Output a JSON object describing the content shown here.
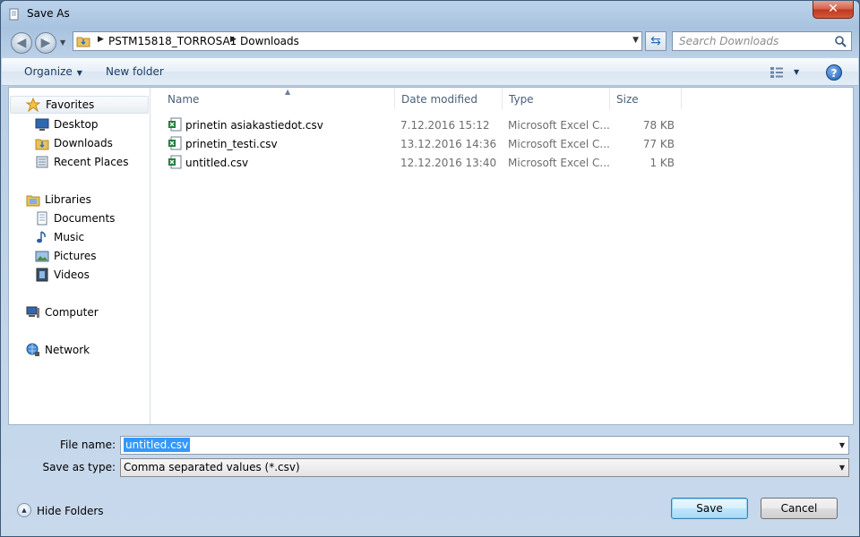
{
  "window": {
    "title": "Save As",
    "close_label": "✕"
  },
  "address": {
    "crumbs": [
      "PSTM15818_TORROSA1",
      "Downloads"
    ],
    "search_placeholder": "Search Downloads"
  },
  "toolbar": {
    "organize_label": "Organize",
    "new_folder_label": "New folder",
    "help_label": "?"
  },
  "sidebar": {
    "favorites": {
      "label": "Favorites",
      "items": [
        "Desktop",
        "Downloads",
        "Recent Places"
      ]
    },
    "libraries": {
      "label": "Libraries",
      "items": [
        "Documents",
        "Music",
        "Pictures",
        "Videos"
      ]
    },
    "computer_label": "Computer",
    "network_label": "Network"
  },
  "file_list": {
    "columns": [
      "Name",
      "Date modified",
      "Type",
      "Size"
    ],
    "rows": [
      {
        "name": "prinetin asiakastiedot.csv",
        "date": "7.12.2016 15:12",
        "type": "Microsoft Excel C...",
        "size": "78 KB"
      },
      {
        "name": "prinetin_testi.csv",
        "date": "13.12.2016 14:36",
        "type": "Microsoft Excel C...",
        "size": "77 KB"
      },
      {
        "name": "untitled.csv",
        "date": "12.12.2016 13:40",
        "type": "Microsoft Excel C...",
        "size": "1 KB"
      }
    ]
  },
  "form": {
    "file_name_label": "File name:",
    "file_name_value": "untitled.csv",
    "save_type_label": "Save as type:",
    "save_type_value": "Comma separated values (*.csv)"
  },
  "footer": {
    "hide_folders_label": "Hide Folders",
    "save_label": "Save",
    "cancel_label": "Cancel"
  },
  "colors": {
    "accent": "#3399ff",
    "excel_green": "#1f7a3a",
    "folder_yellow": "#e8c25a"
  }
}
